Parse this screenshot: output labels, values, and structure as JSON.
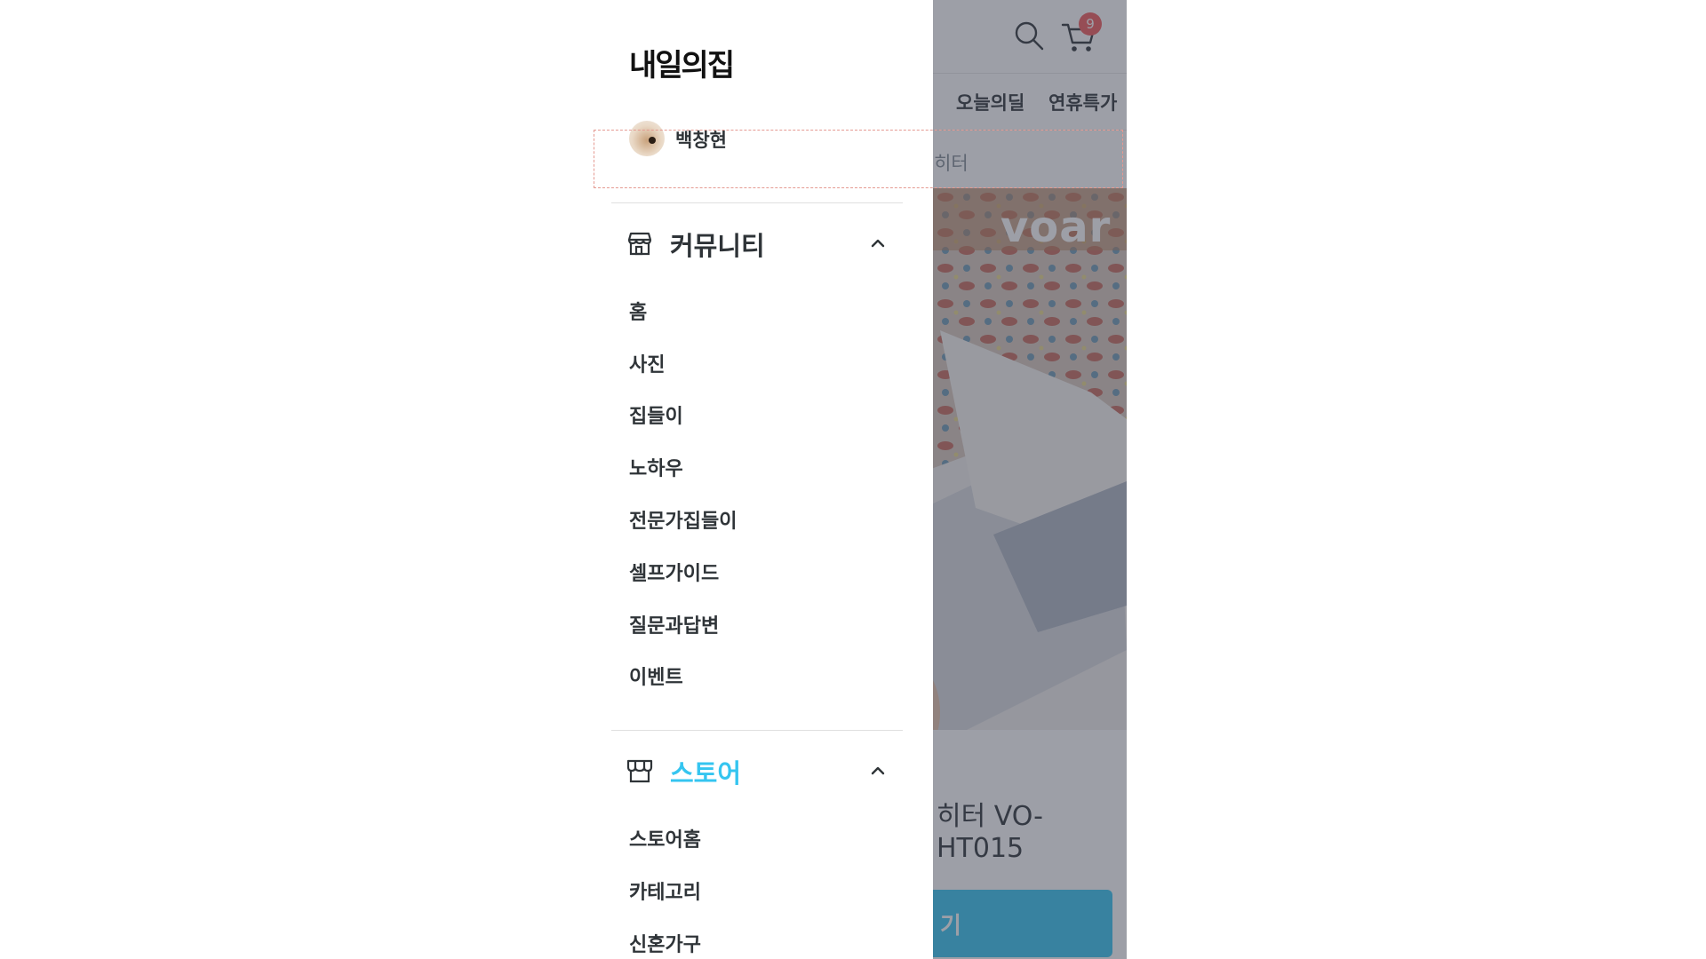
{
  "drawer": {
    "brand": "내일의집",
    "profile": {
      "name": "백창현"
    },
    "community": {
      "title": "커뮤니티",
      "icon": "storefront-icon",
      "expanded": true,
      "items": [
        "홈",
        "사진",
        "집들이",
        "노하우",
        "전문가집들이",
        "셀프가이드",
        "질문과답변",
        "이벤트"
      ]
    },
    "store": {
      "title": "스토어",
      "icon": "store-awning-icon",
      "expanded": true,
      "items": [
        "스토어홈",
        "카테고리",
        "신혼가구"
      ]
    }
  },
  "background": {
    "cart_count": "9",
    "tabs": [
      "오늘의딜",
      "연휴특가"
    ],
    "breadcrumb_fragment": "|히터",
    "brand_logo": "voar",
    "product_title_fragment": "히터 VO-HT015",
    "button_fragment": "기"
  },
  "colors": {
    "accent": "#35c5f0",
    "text": "#2f3438",
    "badge": "#f15a5a",
    "overlay": "rgba(60,64,80,0.5)"
  }
}
